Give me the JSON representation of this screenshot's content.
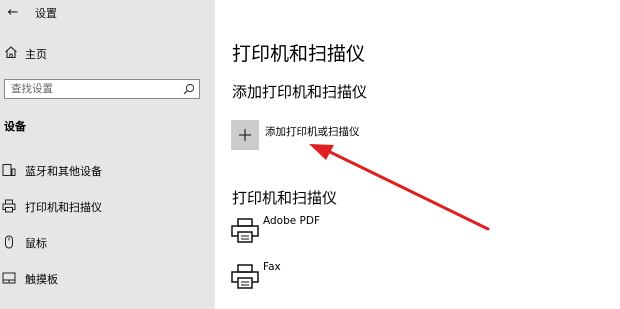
{
  "window": {
    "title": "设置",
    "back_glyph": "←"
  },
  "sidebar": {
    "home_label": "主页",
    "search": {
      "placeholder": "查找设置"
    },
    "section_title": "设备",
    "items": [
      {
        "label": "蓝牙和其他设备",
        "icon": "bluetooth-devices-icon"
      },
      {
        "label": "打印机和扫描仪",
        "icon": "printer-icon"
      },
      {
        "label": "鼠标",
        "icon": "mouse-icon"
      },
      {
        "label": "触摸板",
        "icon": "touchpad-icon"
      }
    ]
  },
  "main": {
    "page_title": "打印机和扫描仪",
    "add_section_title": "添加打印机和扫描仪",
    "add_button_glyph": "+",
    "add_button_label": "添加打印机或扫描仪",
    "list_section_title": "打印机和扫描仪",
    "printers": [
      {
        "name": "Adobe PDF",
        "icon": "printer-icon"
      },
      {
        "name": "Fax",
        "icon": "printer-icon"
      }
    ]
  },
  "annotation": {
    "arrow_color": "#e02020"
  }
}
